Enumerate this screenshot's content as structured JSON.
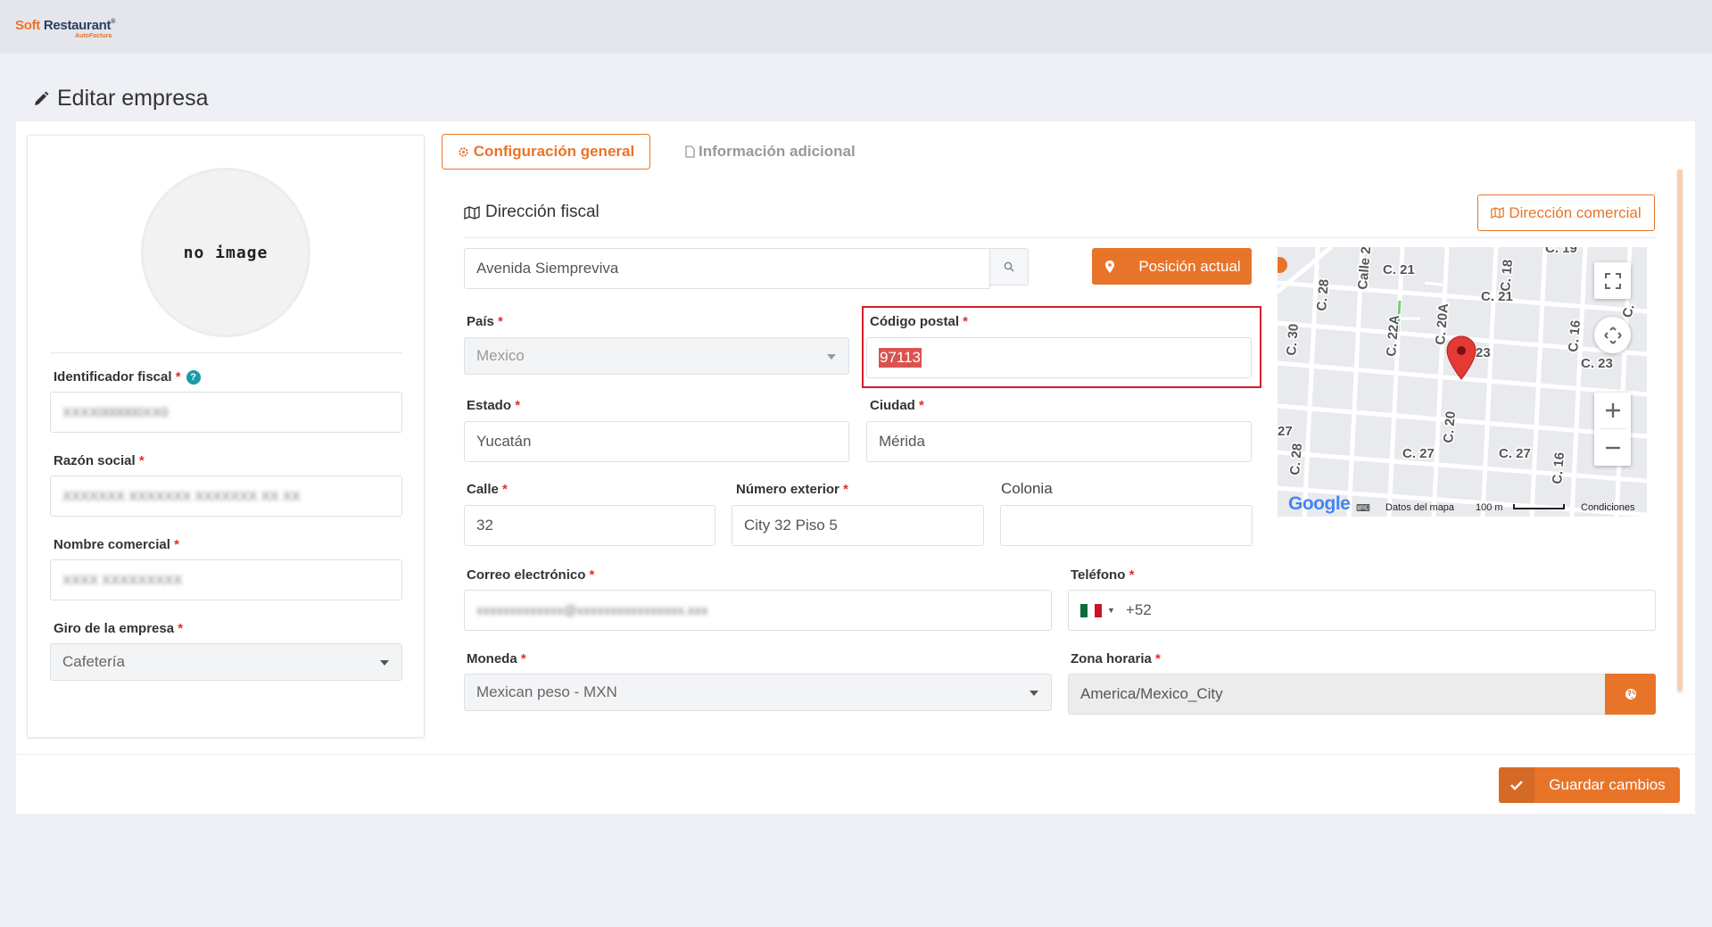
{
  "brand": {
    "logo_soft": "Soft ",
    "logo_restaurant": "Restaurant",
    "logo_tm": "®",
    "logo_sub": "AutoFactura"
  },
  "page": {
    "title": "Editar empresa"
  },
  "left": {
    "avatar_text": "no image",
    "fiscal_id": {
      "label": "Identificador fiscal",
      "value": "XXXX000000XX0"
    },
    "razon_social": {
      "label": "Razón social",
      "value": "XXXXXXX XXXXXXX XXXXXXX XX XX"
    },
    "nombre_comercial": {
      "label": "Nombre comercial",
      "value": "XXXX XXXXXXXXX"
    },
    "giro": {
      "label": "Giro de la empresa",
      "value": "Cafetería"
    }
  },
  "tabs": {
    "general": "Configuración general",
    "adicional": "Información adicional"
  },
  "section": {
    "title": "Dirección fiscal",
    "commercial_button": "Dirección comercial"
  },
  "search": {
    "value": "Avenida Siempreviva"
  },
  "position_button": "Posición actual",
  "fields": {
    "pais": {
      "label": "País",
      "value": "Mexico"
    },
    "cp": {
      "label": "Código postal",
      "value": "97113"
    },
    "estado": {
      "label": "Estado",
      "value": "Yucatán"
    },
    "ciudad": {
      "label": "Ciudad",
      "value": "Mérida"
    },
    "calle": {
      "label": "Calle",
      "value": "32"
    },
    "num_ext": {
      "label": "Número exterior",
      "value": "City 32 Piso 5"
    },
    "colonia": {
      "label": "Colonia",
      "value": ""
    },
    "correo": {
      "label": "Correo electrónico",
      "value": "xxxxxxxxxxxxx@xxxxxxxxxxxxxxxx.xxx"
    },
    "telefono": {
      "label": "Teléfono",
      "value": "+52"
    },
    "moneda": {
      "label": "Moneda",
      "value": "Mexican peso - MXN"
    },
    "zona": {
      "label": "Zona horaria",
      "value": "America/Mexico_City"
    }
  },
  "required_mark": "*",
  "map": {
    "streets": [
      "C. 28",
      "Calle 2",
      "C. 21",
      "C. 18",
      "C. 19",
      "C. 21",
      "C. 30",
      "C. 22A",
      "C. 20A",
      "C. 16",
      "23",
      "C. 23",
      "27",
      "C. 28",
      "C. 20",
      "C. 27",
      "C. 27",
      "C. 16",
      "C."
    ],
    "google": "Google",
    "datos": "Datos del mapa",
    "scale": "100 m",
    "condiciones": "Condiciones"
  },
  "save_button": "Guardar cambios",
  "colors": {
    "accent": "#e8742a",
    "highlight_border": "#d21f2a",
    "required": "#d9322f"
  }
}
